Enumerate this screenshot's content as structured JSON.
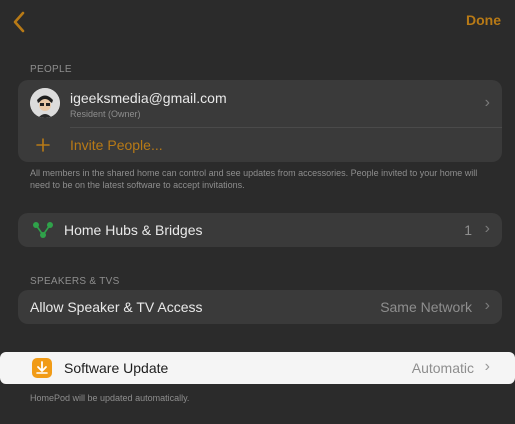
{
  "nav": {
    "back_icon": "chevron-left-icon",
    "done_label": "Done"
  },
  "people": {
    "header": "PEOPLE",
    "owner_email": "igeeksmedia@gmail.com",
    "owner_role": "Resident (Owner)",
    "invite_label": "Invite People...",
    "note": "All members in the shared home can control and see updates from accessories. People invited to your home will need to be on the latest software to accept invitations."
  },
  "hubs": {
    "label": "Home Hubs & Bridges",
    "count": "1"
  },
  "speakers": {
    "header": "SPEAKERS & TVS",
    "label": "Allow Speaker & TV Access",
    "value": "Same Network"
  },
  "software_update": {
    "label": "Software Update",
    "value": "Automatic",
    "note": "HomePod will be updated automatically."
  },
  "colors": {
    "accent": "#b87a16",
    "update_icon": "#f19b16",
    "highlight": "#f5f5f5"
  }
}
